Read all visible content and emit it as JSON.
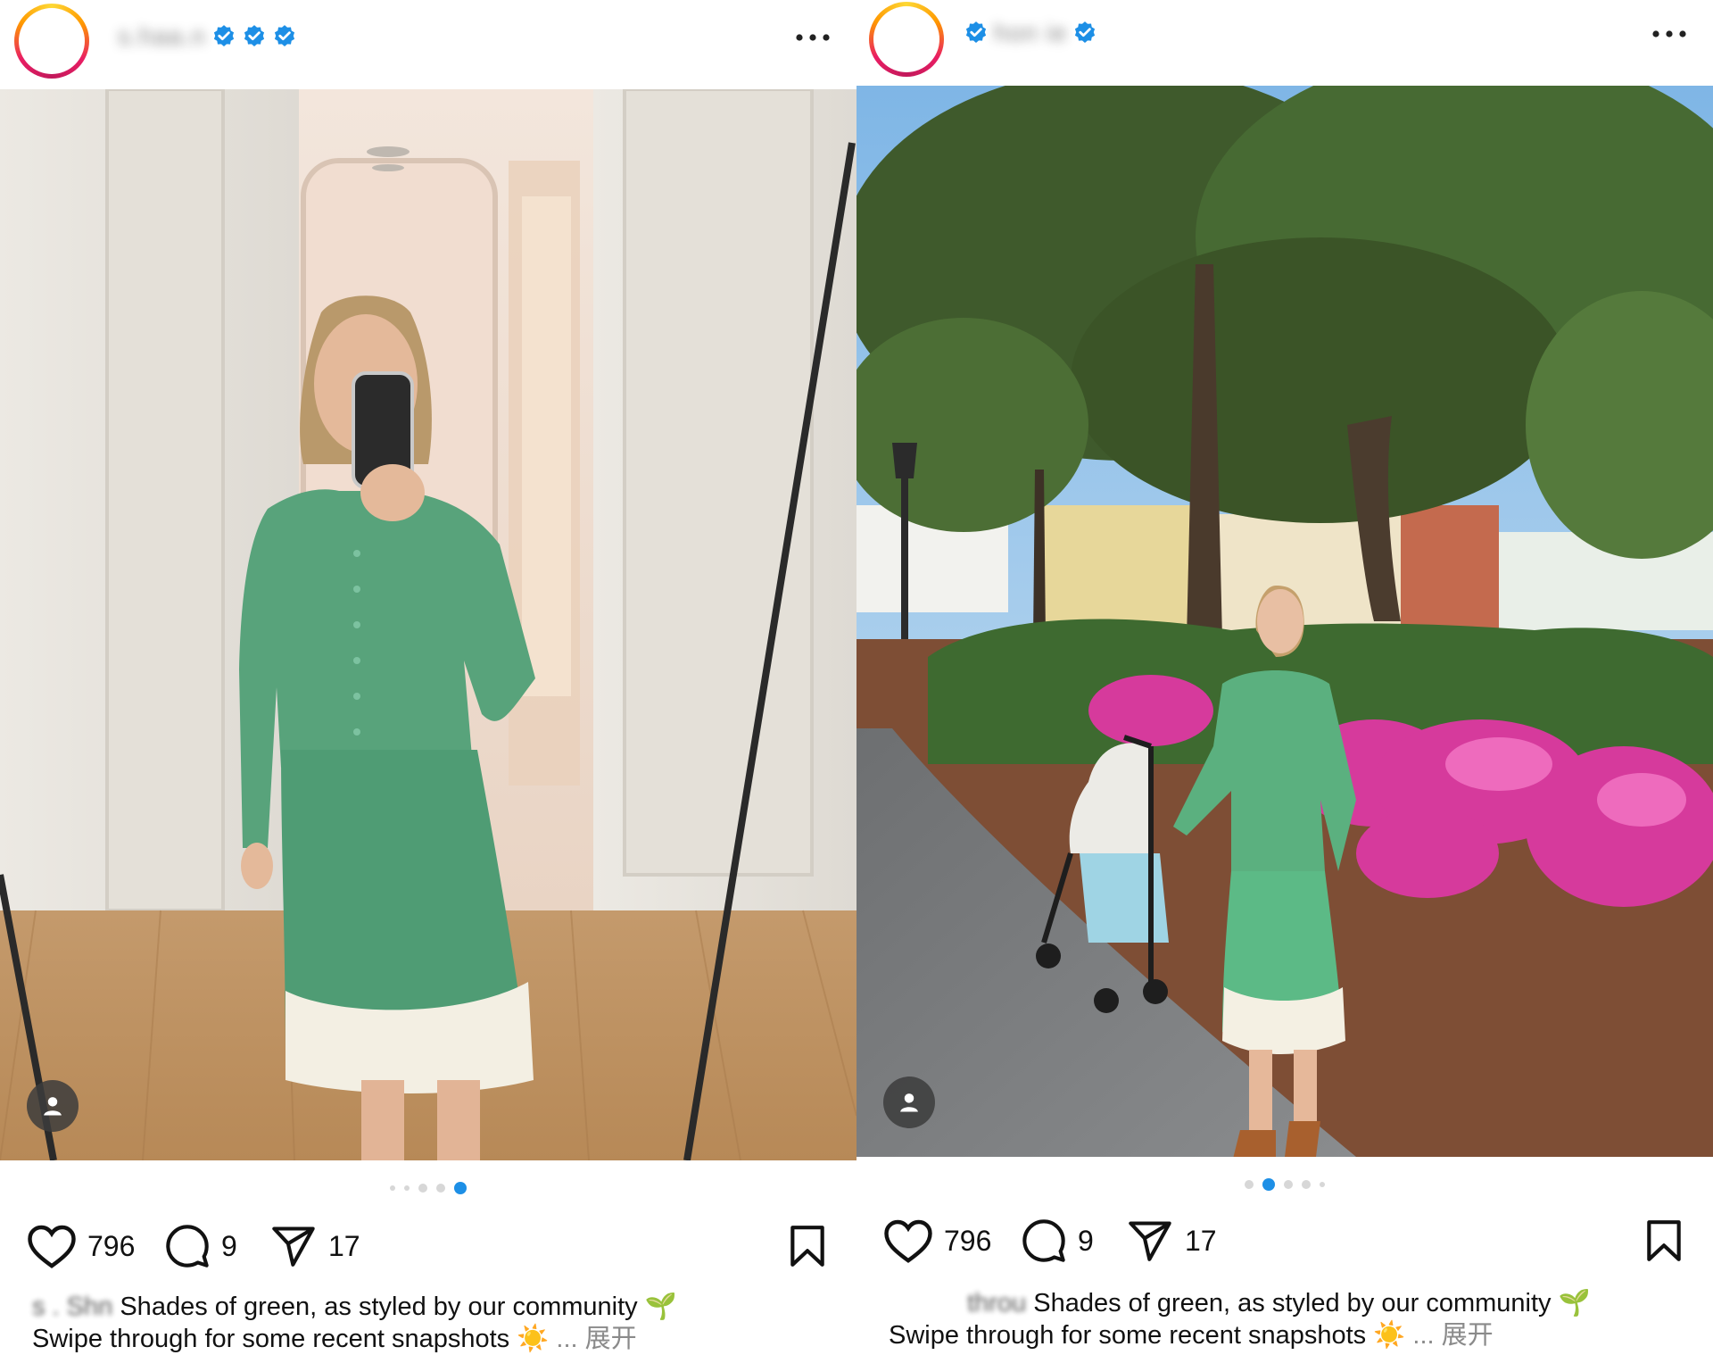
{
  "posts": [
    {
      "username": "s.haa.n",
      "likes": "796",
      "comments": "9",
      "shares": "17",
      "carousel": {
        "count": 5,
        "active": 5
      },
      "caption": {
        "author_prefix": "s  .  Shn",
        "line1": "Shades of green, as styled by our community",
        "line1_emoji": "🌱",
        "line2": "Swipe through for some recent snapshots",
        "line2_emoji": "☀️",
        "more": "... 展开"
      }
    },
    {
      "username": "hon ie",
      "likes": "796",
      "comments": "9",
      "shares": "17",
      "carousel": {
        "count": 5,
        "active": 2
      },
      "caption": {
        "author_prefix": "throu",
        "line1": "Shades of green, as styled by our community",
        "line1_emoji": "🌱",
        "line2": "Swipe through for some recent snapshots",
        "line2_emoji": "☀️",
        "more": "... 展开"
      }
    }
  ],
  "icons": {
    "like": "heart-icon",
    "comment": "comment-icon",
    "share": "send-icon",
    "save": "bookmark-icon",
    "more": "more-options-icon",
    "verified": "verified-badge-icon",
    "user_tag": "user-tag-icon"
  },
  "colors": {
    "verified_blue": "#1d8fe6",
    "dress_green": "#4fa27a",
    "azalea_pink": "#d63a9c",
    "active_dot": "#1d8fe6"
  }
}
